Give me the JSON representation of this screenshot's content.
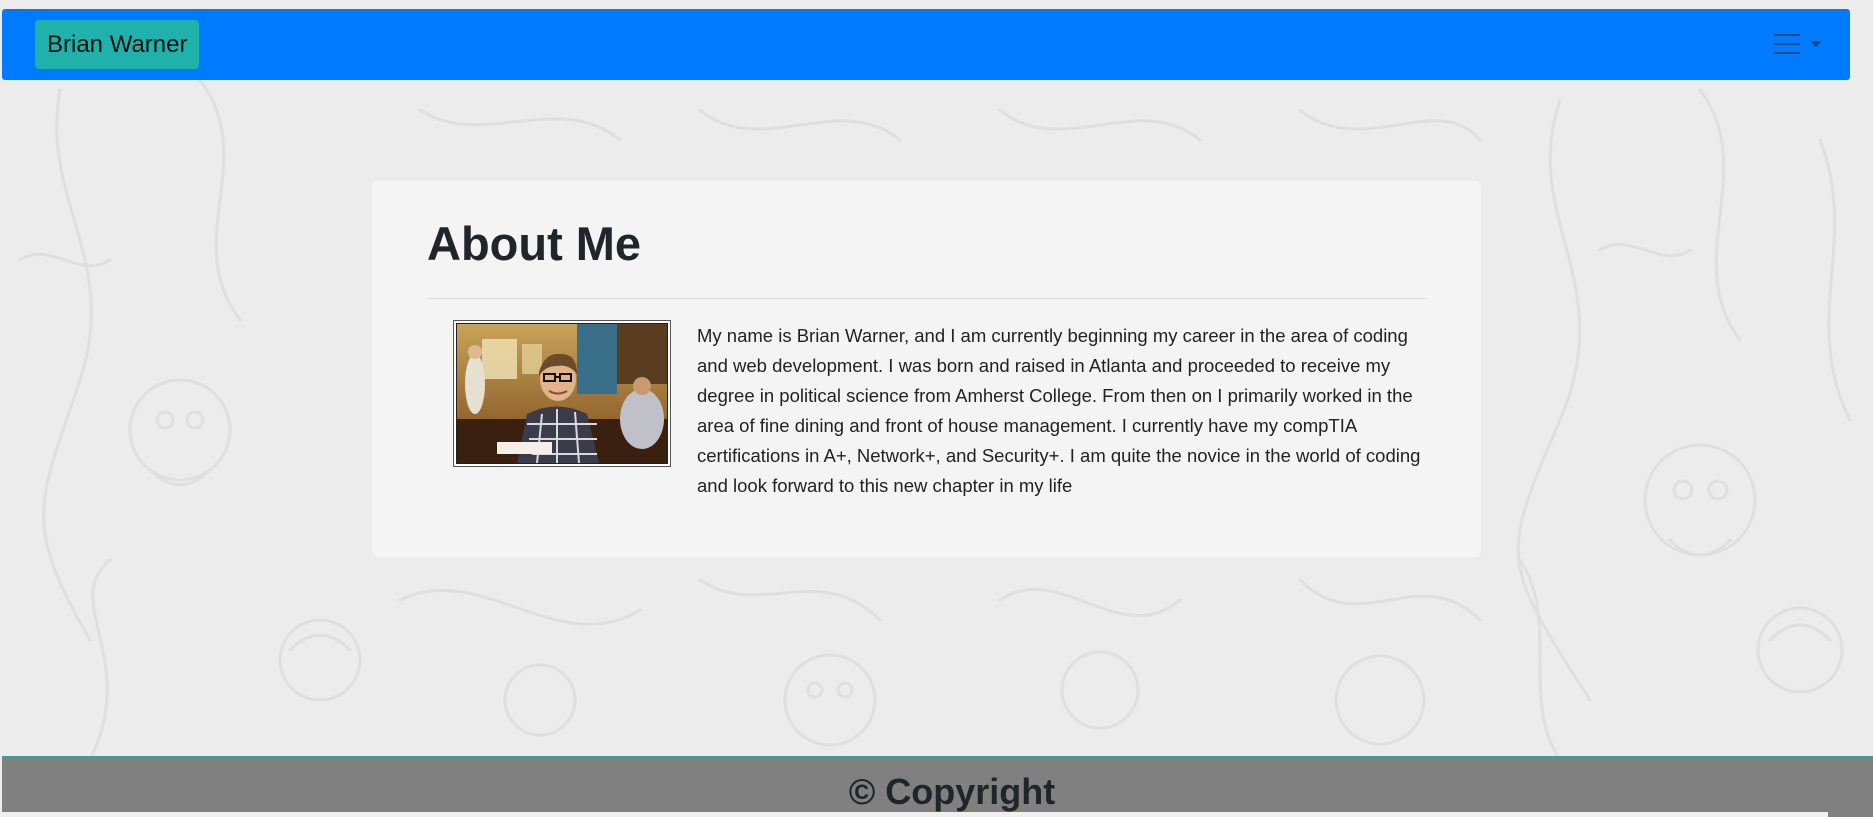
{
  "navbar": {
    "brand": "Brian Warner",
    "menu_icon": "hamburger-icon",
    "dropdown_icon": "caret-down-icon",
    "color": "#007bff",
    "brand_color": "#20b2aa"
  },
  "about": {
    "title": "About Me",
    "bio": "My name is Brian Warner, and I am currently beginning my career in the area of coding and web development. I was born and raised in Atlanta and proceeded to receive my degree in political science from Amherst College. From then on I primarily worked in the area of fine dining and front of house management. I currently have my compTIA certifications in A+, Network+, and Security+. I am quite the novice in the world of coding and look forward to this new chapter in my life"
  },
  "footer": {
    "text": "© Copyright",
    "color": "#808080",
    "border_color": "#2aa8a0"
  }
}
